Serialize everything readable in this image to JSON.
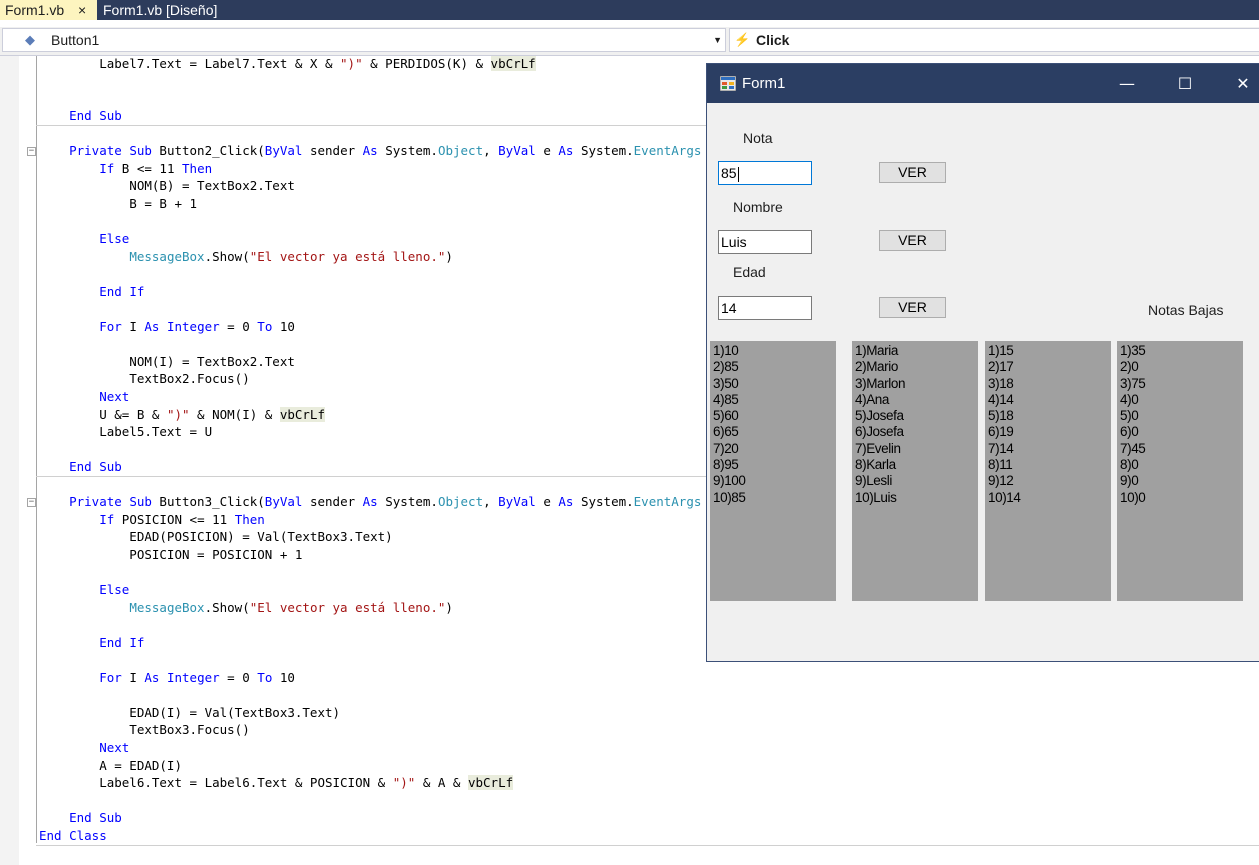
{
  "tabs": [
    {
      "label": "Form1.vb",
      "active": true,
      "close": "×"
    },
    {
      "label": "Form1.vb [Diseño]",
      "active": false
    }
  ],
  "navbar": {
    "object": "Button1",
    "event": "Click"
  },
  "colors": {
    "keyword": "#0000ff",
    "type": "#2b91af",
    "string": "#a31515",
    "tab_active": "#fdf4bf",
    "titlebar": "#2b3e63",
    "listbox": "#a0a0a0"
  },
  "code": [
    [
      {
        "t": "        Label7.Text = Label7.Text & X & "
      },
      {
        "t": "\")\"",
        "c": "st"
      },
      {
        "t": " & PERDIDOS(K) & "
      },
      {
        "t": "vbCrLf",
        "c": "hl"
      }
    ],
    [],
    [],
    [
      {
        "t": "    "
      },
      {
        "t": "End Sub",
        "c": "kw"
      }
    ],
    [],
    [
      {
        "t": "    "
      },
      {
        "t": "Private Sub",
        "c": "kw"
      },
      {
        "t": " Button2_Click("
      },
      {
        "t": "ByVal",
        "c": "kw"
      },
      {
        "t": " sender "
      },
      {
        "t": "As",
        "c": "kw"
      },
      {
        "t": " System."
      },
      {
        "t": "Object",
        "c": "ty"
      },
      {
        "t": ", "
      },
      {
        "t": "ByVal",
        "c": "kw"
      },
      {
        "t": " e "
      },
      {
        "t": "As",
        "c": "kw"
      },
      {
        "t": " System."
      },
      {
        "t": "EventArgs",
        "c": "ty"
      }
    ],
    [
      {
        "t": "        "
      },
      {
        "t": "If",
        "c": "kw"
      },
      {
        "t": " B <= 11 "
      },
      {
        "t": "Then",
        "c": "kw"
      }
    ],
    [
      {
        "t": "            NOM(B) = TextBox2.Text"
      }
    ],
    [
      {
        "t": "            B = B + 1"
      }
    ],
    [],
    [
      {
        "t": "        "
      },
      {
        "t": "Else",
        "c": "kw"
      }
    ],
    [
      {
        "t": "            "
      },
      {
        "t": "MessageBox",
        "c": "ty"
      },
      {
        "t": ".Show("
      },
      {
        "t": "\"El vector ya está lleno.\"",
        "c": "st"
      },
      {
        "t": ")"
      }
    ],
    [],
    [
      {
        "t": "        "
      },
      {
        "t": "End If",
        "c": "kw"
      }
    ],
    [],
    [
      {
        "t": "        "
      },
      {
        "t": "For",
        "c": "kw"
      },
      {
        "t": " I "
      },
      {
        "t": "As",
        "c": "kw"
      },
      {
        "t": " "
      },
      {
        "t": "Integer",
        "c": "kw"
      },
      {
        "t": " = 0 "
      },
      {
        "t": "To",
        "c": "kw"
      },
      {
        "t": " 10"
      }
    ],
    [],
    [
      {
        "t": "            NOM(I) = TextBox2.Text"
      }
    ],
    [
      {
        "t": "            TextBox2.Focus()"
      }
    ],
    [
      {
        "t": "        "
      },
      {
        "t": "Next",
        "c": "kw"
      }
    ],
    [
      {
        "t": "        U &= B & "
      },
      {
        "t": "\")\"",
        "c": "st"
      },
      {
        "t": " & NOM(I) & "
      },
      {
        "t": "vbCrLf",
        "c": "hl"
      }
    ],
    [
      {
        "t": "        Label5.Text = U"
      }
    ],
    [],
    [
      {
        "t": "    "
      },
      {
        "t": "End Sub",
        "c": "kw"
      }
    ],
    [],
    [
      {
        "t": "    "
      },
      {
        "t": "Private Sub",
        "c": "kw"
      },
      {
        "t": " Button3_Click("
      },
      {
        "t": "ByVal",
        "c": "kw"
      },
      {
        "t": " sender "
      },
      {
        "t": "As",
        "c": "kw"
      },
      {
        "t": " System."
      },
      {
        "t": "Object",
        "c": "ty"
      },
      {
        "t": ", "
      },
      {
        "t": "ByVal",
        "c": "kw"
      },
      {
        "t": " e "
      },
      {
        "t": "As",
        "c": "kw"
      },
      {
        "t": " System."
      },
      {
        "t": "EventArgs",
        "c": "ty"
      }
    ],
    [
      {
        "t": "        "
      },
      {
        "t": "If",
        "c": "kw"
      },
      {
        "t": " POSICION <= 11 "
      },
      {
        "t": "Then",
        "c": "kw"
      }
    ],
    [
      {
        "t": "            EDAD(POSICION) = Val(TextBox3.Text)"
      }
    ],
    [
      {
        "t": "            POSICION = POSICION + 1"
      }
    ],
    [],
    [
      {
        "t": "        "
      },
      {
        "t": "Else",
        "c": "kw"
      }
    ],
    [
      {
        "t": "            "
      },
      {
        "t": "MessageBox",
        "c": "ty"
      },
      {
        "t": ".Show("
      },
      {
        "t": "\"El vector ya está lleno.\"",
        "c": "st"
      },
      {
        "t": ")"
      }
    ],
    [],
    [
      {
        "t": "        "
      },
      {
        "t": "End If",
        "c": "kw"
      }
    ],
    [],
    [
      {
        "t": "        "
      },
      {
        "t": "For",
        "c": "kw"
      },
      {
        "t": " I "
      },
      {
        "t": "As",
        "c": "kw"
      },
      {
        "t": " "
      },
      {
        "t": "Integer",
        "c": "kw"
      },
      {
        "t": " = 0 "
      },
      {
        "t": "To",
        "c": "kw"
      },
      {
        "t": " 10"
      }
    ],
    [],
    [
      {
        "t": "            EDAD(I) = Val(TextBox3.Text)"
      }
    ],
    [
      {
        "t": "            TextBox3.Focus()"
      }
    ],
    [
      {
        "t": "        "
      },
      {
        "t": "Next",
        "c": "kw"
      }
    ],
    [
      {
        "t": "        A = EDAD(I)"
      }
    ],
    [
      {
        "t": "        Label6.Text = Label6.Text & POSICION & "
      },
      {
        "t": "\")\"",
        "c": "st"
      },
      {
        "t": " & A & "
      },
      {
        "t": "vbCrLf",
        "c": "hl"
      }
    ],
    [],
    [
      {
        "t": "    "
      },
      {
        "t": "End Sub",
        "c": "kw"
      }
    ],
    [
      {
        "t": ""
      },
      {
        "t": "End Class",
        "c": "kw"
      }
    ]
  ],
  "fold_markers": [
    "−",
    "−"
  ],
  "form1": {
    "title": "Form1",
    "minimize": "—",
    "maximize": "☐",
    "close": "✕",
    "labels": {
      "nota": "Nota",
      "nombre": "Nombre",
      "edad": "Edad",
      "notas_bajas": "Notas Bajas"
    },
    "textboxes": {
      "nota": "85",
      "nombre": "Luis",
      "edad": "14"
    },
    "buttons": [
      "VER",
      "VER",
      "VER"
    ],
    "lists": [
      [
        "1)10",
        "2)85",
        "3)50",
        "4)85",
        "5)60",
        "6)65",
        "7)20",
        "8)95",
        "9)100",
        "10)85"
      ],
      [
        "1)Maria",
        "2)Mario",
        "3)Marlon",
        "4)Ana",
        "5)Josefa",
        "6)Josefa",
        "7)Evelin",
        "8)Karla",
        "9)Lesli",
        "10)Luis"
      ],
      [
        "1)15",
        "2)17",
        "3)18",
        "4)14",
        "5)18",
        "6)19",
        "7)14",
        "8)11",
        "9)12",
        "10)14"
      ],
      [
        "1)35",
        "2)0",
        "3)75",
        "4)0",
        "5)0",
        "6)0",
        "7)45",
        "8)0",
        "9)0",
        "10)0"
      ]
    ]
  }
}
